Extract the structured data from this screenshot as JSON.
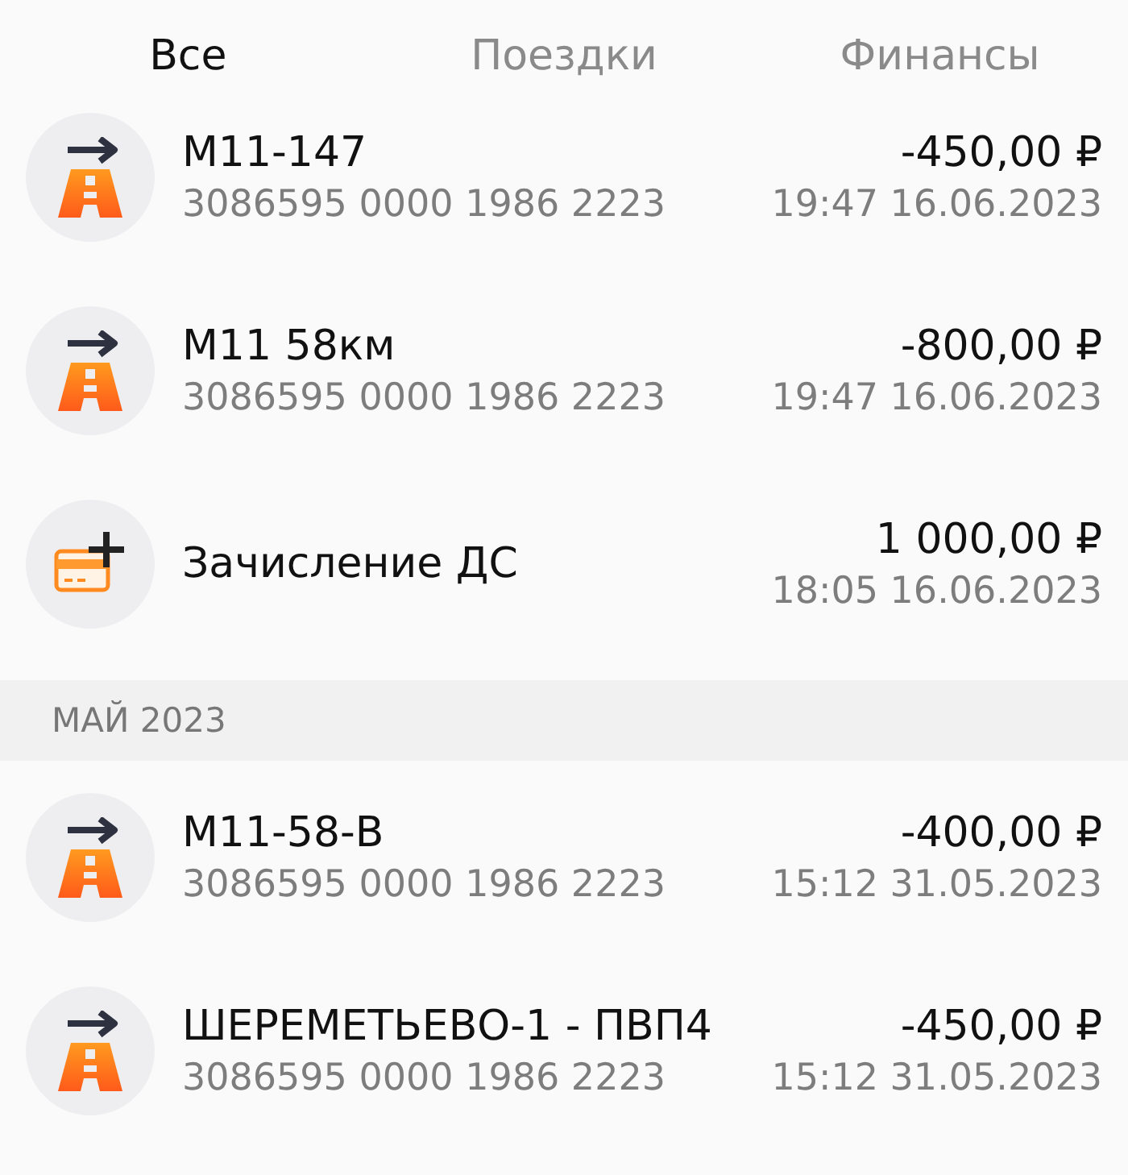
{
  "tabs": [
    {
      "label": "Все",
      "selected": true
    },
    {
      "label": "Поездки",
      "selected": false
    },
    {
      "label": "Финансы",
      "selected": false
    }
  ],
  "groups": [
    {
      "items": [
        {
          "kind": "trip",
          "title": "М11-147",
          "subtitle": "3086595 0000 1986 2223",
          "amount": "-450,00 ₽",
          "time": "19:47 16.06.2023"
        },
        {
          "kind": "trip",
          "title": "М11 58км",
          "subtitle": "3086595 0000 1986 2223",
          "amount": "-800,00 ₽",
          "time": "19:47 16.06.2023"
        },
        {
          "kind": "deposit",
          "title": "Зачисление ДС",
          "amount": "1 000,00 ₽",
          "time": "18:05 16.06.2023"
        }
      ]
    },
    {
      "header": "МАЙ 2023",
      "items": [
        {
          "kind": "trip",
          "title": "М11-58-В",
          "subtitle": "3086595 0000 1986 2223",
          "amount": "-400,00 ₽",
          "time": "15:12 31.05.2023"
        },
        {
          "kind": "trip",
          "title": "ШЕРЕМЕТЬЕВО-1 - ПВП4",
          "subtitle": "3086595 0000 1986 2223",
          "amount": "-450,00 ₽",
          "time": "15:12 31.05.2023"
        }
      ]
    }
  ]
}
